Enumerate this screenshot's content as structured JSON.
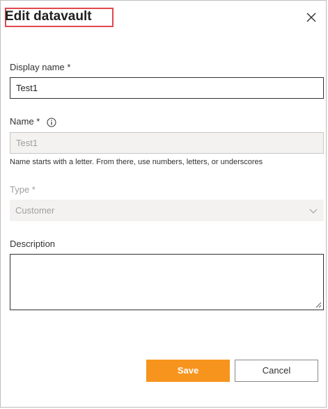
{
  "dialog": {
    "title": "Edit datavault",
    "close_icon": "close-icon"
  },
  "display_name": {
    "label": "Display name *",
    "value": "Test1"
  },
  "name": {
    "label": "Name *",
    "info_icon": "info-icon",
    "value": "Test1",
    "hint": "Name starts with a letter. From there, use numbers, letters, or underscores"
  },
  "type": {
    "label": "Type *",
    "selected": "Customer",
    "chevron_icon": "chevron-down-icon"
  },
  "description": {
    "label": "Description",
    "value": ""
  },
  "footer": {
    "save_label": "Save",
    "cancel_label": "Cancel"
  },
  "colors": {
    "title_highlight": "#e0474c",
    "primary_button": "#f7941d",
    "disabled_background": "#f3f2f1"
  }
}
